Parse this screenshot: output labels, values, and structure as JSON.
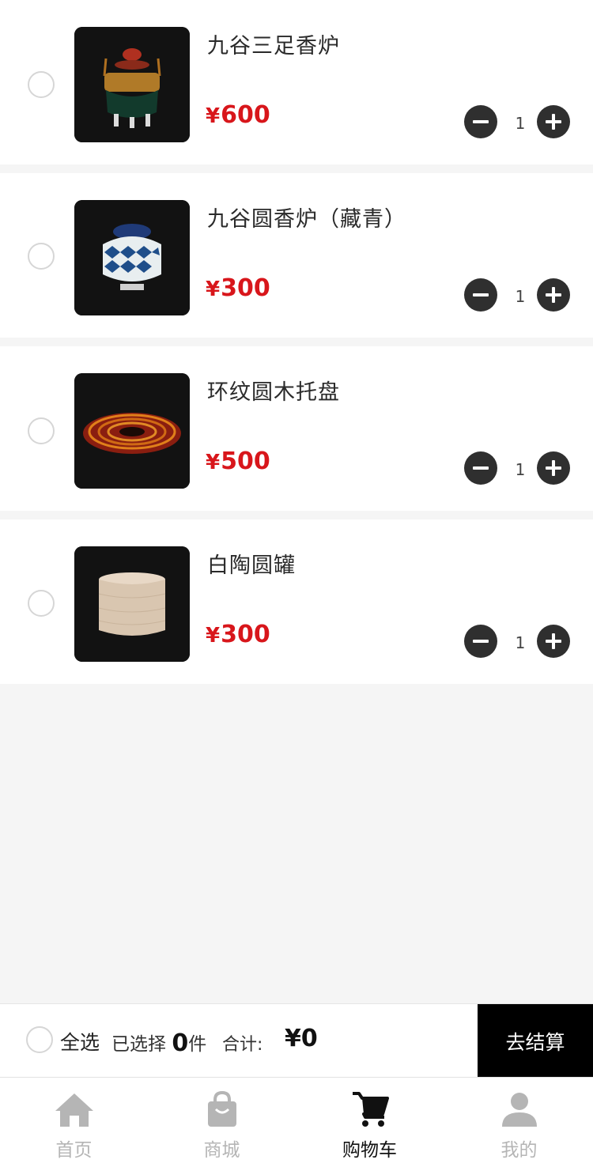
{
  "cart": {
    "items": [
      {
        "name": "九谷三足香炉",
        "currency": "¥",
        "price": "600",
        "qty": "1",
        "image": "incense-burner-tripod-image"
      },
      {
        "name": "九谷圆香炉（藏青）",
        "currency": "¥",
        "price": "300",
        "qty": "1",
        "image": "round-incense-burner-image"
      },
      {
        "name": "环纹圆木托盘",
        "currency": "¥",
        "price": "500",
        "qty": "1",
        "image": "ring-pattern-wood-tray-image"
      },
      {
        "name": "白陶圆罐",
        "currency": "¥",
        "price": "300",
        "qty": "1",
        "image": "white-pottery-jar-image"
      }
    ]
  },
  "checkout": {
    "select_all": "全选",
    "selected_prefix": "已选择",
    "selected_count": "0",
    "selected_suffix": "件",
    "total_label": "合计:",
    "total_value": "¥0",
    "button": "去结算"
  },
  "tabbar": {
    "tabs": [
      {
        "label": "首页",
        "icon": "home-icon"
      },
      {
        "label": "商城",
        "icon": "shopping-bag-icon"
      },
      {
        "label": "购物车",
        "icon": "cart-icon",
        "active": true
      },
      {
        "label": "我的",
        "icon": "user-icon"
      }
    ]
  },
  "colors": {
    "price": "#d8161b",
    "checkout_button": "#000000",
    "tab_inactive": "#b5b5b5",
    "tab_active": "#111111"
  }
}
